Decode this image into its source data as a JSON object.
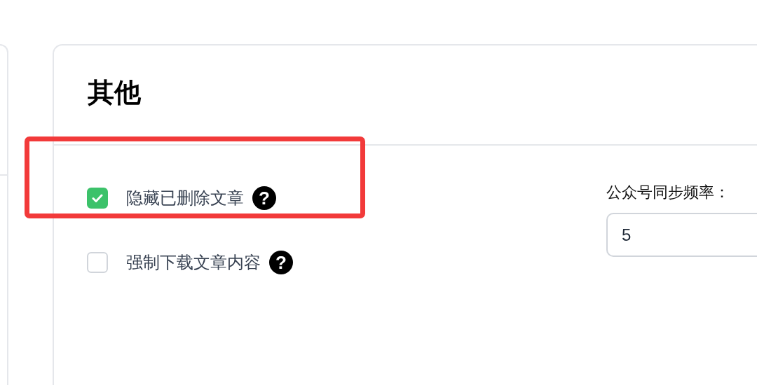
{
  "section": {
    "title": "其他"
  },
  "options": [
    {
      "label": "隐藏已删除文章",
      "checked": true,
      "highlighted": true,
      "help": "?"
    },
    {
      "label": "强制下载文章内容",
      "checked": false,
      "highlighted": false,
      "help": "?"
    }
  ],
  "sync_field": {
    "label": "公众号同步频率：",
    "value": "5"
  }
}
